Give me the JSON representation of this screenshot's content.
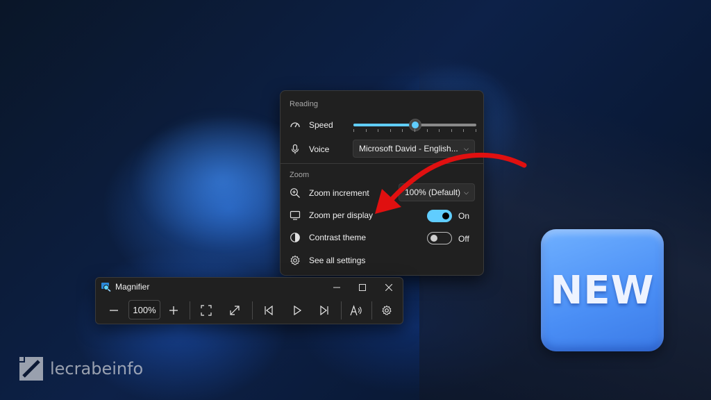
{
  "flyout": {
    "reading_label": "Reading",
    "speed_label": "Speed",
    "speed_level": 0.5,
    "voice_label": "Voice",
    "voice_value": "Microsoft David - English...",
    "zoom_label": "Zoom",
    "zoom_increment_label": "Zoom increment",
    "zoom_increment_value": "100% (Default)",
    "zoom_per_display_label": "Zoom per display",
    "zoom_per_display_state": "On",
    "contrast_theme_label": "Contrast theme",
    "contrast_theme_state": "Off",
    "see_all_settings_label": "See all settings"
  },
  "magnifier": {
    "title": "Magnifier",
    "zoom_level": "100%"
  },
  "badge": {
    "text": "NEW"
  },
  "watermark": {
    "brand": "lecrabeinfo"
  },
  "colors": {
    "accent": "#60cdff",
    "panel": "#202020",
    "arrow": "#e01010",
    "badge": "#4a8ef5"
  }
}
